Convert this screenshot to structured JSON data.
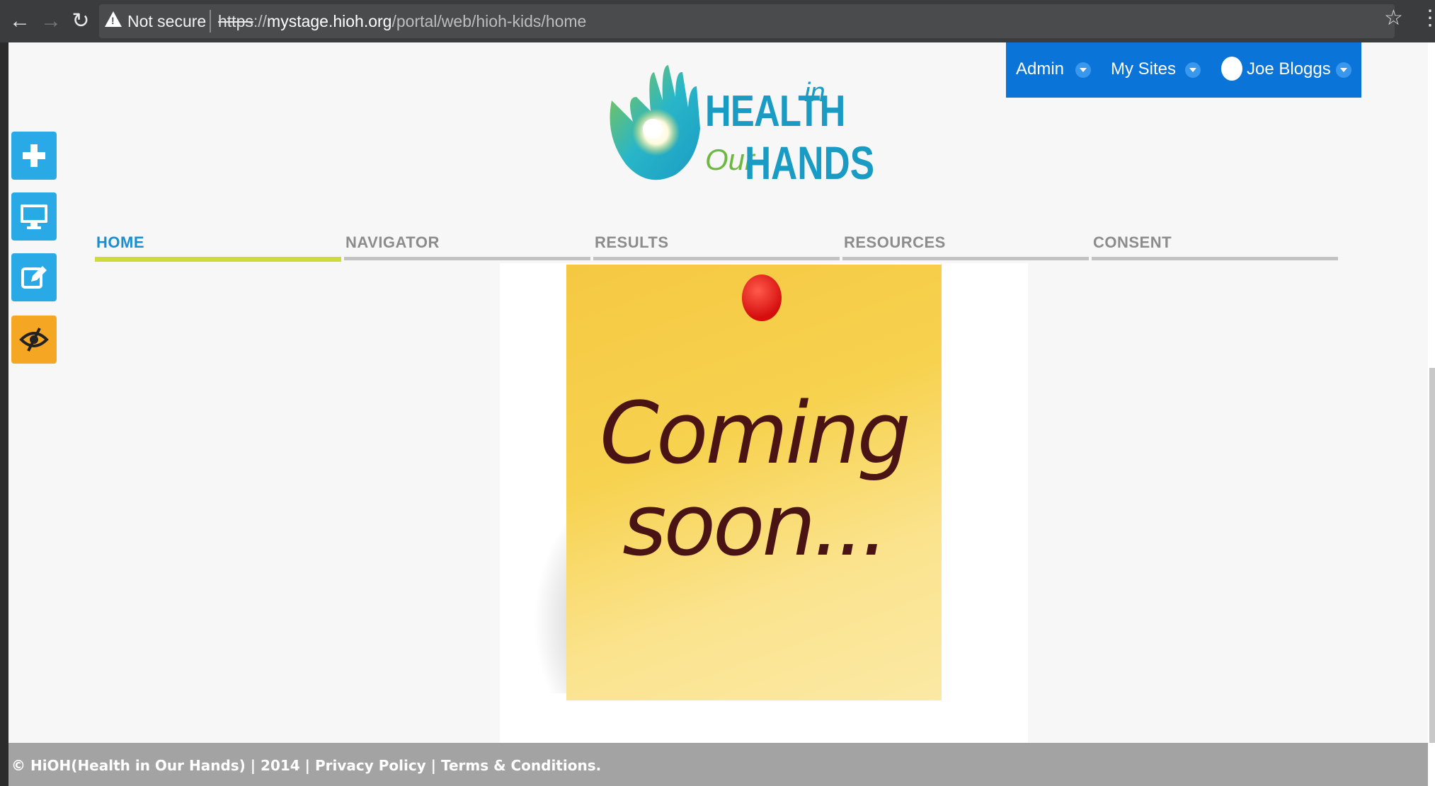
{
  "browser": {
    "not_secure": "Not secure",
    "url_scheme": "https",
    "url_sep": "://",
    "url_host": "mystage.hioh.org",
    "url_path": "/portal/web/hioh-kids/home"
  },
  "logo": {
    "line1": "HEALTH",
    "sup": "in",
    "our": "Our",
    "hands": "HANDS"
  },
  "dockbar": {
    "admin": "Admin",
    "my_sites": "My Sites",
    "user": "Joe Bloggs"
  },
  "side_actions": [
    {
      "icon": "plus-icon"
    },
    {
      "icon": "desktop-icon"
    },
    {
      "icon": "edit-icon"
    },
    {
      "icon": "eye-slash-icon"
    }
  ],
  "nav": {
    "tabs": [
      "HOME",
      "NAVIGATOR",
      "RESULTS",
      "RESOURCES",
      "CONSENT"
    ],
    "active_index": 0
  },
  "note": {
    "line1": "Coming",
    "line2": "soon..."
  },
  "footer": {
    "copyright": "© HiOH(Health in Our Hands) | 2014 | ",
    "privacy": "Privacy Policy",
    "sep": " | ",
    "terms": "Terms & Conditions."
  },
  "colors": {
    "dock": "#0a74d8",
    "side_button": "#29a9e6",
    "side_button_toggle": "#f5a623",
    "active_tab_bar": "#cddc39",
    "active_tab_text": "#1a8fd0",
    "footer": "#a3a3a3"
  }
}
